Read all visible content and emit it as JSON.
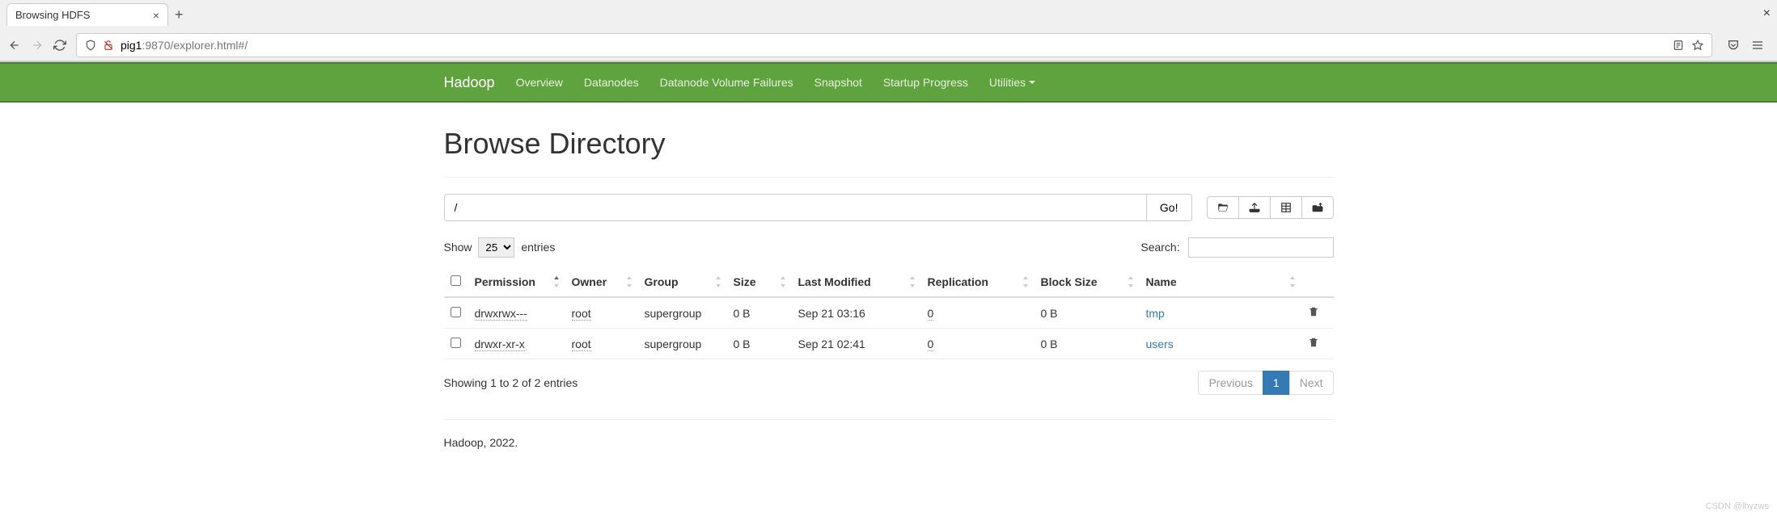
{
  "browser": {
    "tab_title": "Browsing HDFS",
    "url_host": "pig1",
    "url_path": ":9870/explorer.html#/"
  },
  "nav": {
    "brand": "Hadoop",
    "items": [
      "Overview",
      "Datanodes",
      "Datanode Volume Failures",
      "Snapshot",
      "Startup Progress",
      "Utilities"
    ]
  },
  "page": {
    "title": "Browse Directory",
    "path_value": "/",
    "go_label": "Go!"
  },
  "entries": {
    "show_label": "Show",
    "entries_label": "entries",
    "page_size": "25",
    "search_label": "Search:"
  },
  "table": {
    "headers": [
      "Permission",
      "Owner",
      "Group",
      "Size",
      "Last Modified",
      "Replication",
      "Block Size",
      "Name"
    ],
    "rows": [
      {
        "permission": "drwxrwx---",
        "owner": "root",
        "group": "supergroup",
        "size": "0 B",
        "modified": "Sep 21 03:16",
        "replication": "0",
        "block_size": "0 B",
        "name": "tmp"
      },
      {
        "permission": "drwxr-xr-x",
        "owner": "root",
        "group": "supergroup",
        "size": "0 B",
        "modified": "Sep 21 02:41",
        "replication": "0",
        "block_size": "0 B",
        "name": "users"
      }
    ]
  },
  "footer": {
    "info": "Showing 1 to 2 of 2 entries",
    "prev": "Previous",
    "next": "Next",
    "page": "1"
  },
  "page_footer": "Hadoop, 2022.",
  "watermark": "CSDN @lhyzws"
}
